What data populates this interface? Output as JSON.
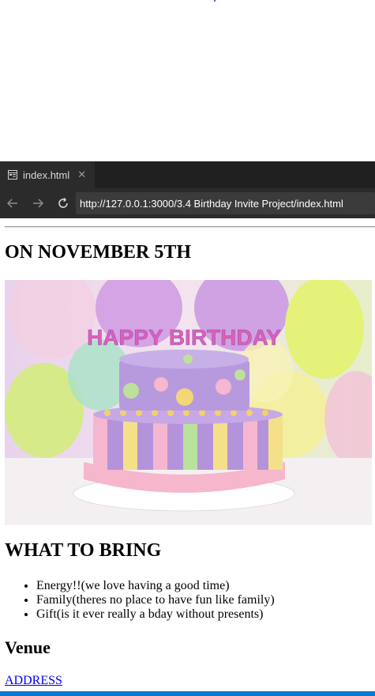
{
  "browser": {
    "tab_title": "index.html",
    "close_symbol": "✕",
    "url": "http://127.0.0.1:3000/3.4 Birthday Invite Project/index.html",
    "icons": [
      "page-icon",
      "back-arrow-icon",
      "forward-arrow-icon",
      "refresh-icon"
    ]
  },
  "content": {
    "date_heading": "ON NOVEMBER 5TH",
    "cake_candles_text": "HAPPY BIRTHDAY",
    "bring_heading": "WHAT TO BRING",
    "bring_items": [
      "Energy!!(we love having a good time)",
      "Family(theres no place to have fun like family)",
      "Gift(is it ever really a bday without presents)"
    ],
    "venue_heading": "Venue",
    "address_link": "ADDRESS"
  },
  "colors": {
    "browser_bg": "#202020",
    "address_bar_bg": "#3b3b3b",
    "link": "#0000ee",
    "bottom_bar": "#0a78d4"
  }
}
